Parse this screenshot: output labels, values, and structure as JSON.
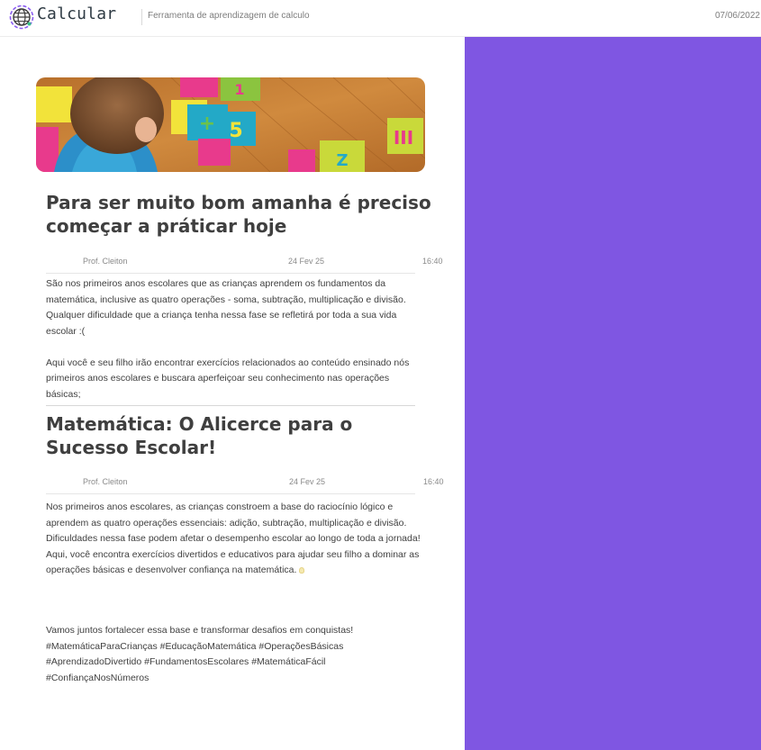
{
  "header": {
    "logo_text": "Calcular",
    "tagline": "Ferramenta de aprendizagem de calculo",
    "date": "07/06/2022"
  },
  "posts": [
    {
      "title": "Para ser muito bom amanha é preciso começar a práticar hoje",
      "author": "Prof. Cleiton",
      "date": "24 Fev 25",
      "time": "16:40",
      "body": "São nos primeiros anos escolares que as crianças aprendem os fundamentos da matemática, inclusive as quatro operações - soma, subtração, multiplicação e divisão. Qualquer dificuldade que a criança tenha nessa fase se refletirá por toda a sua vida escolar :(\n\nAqui você e seu filho irão encontrar exercícios relacionados ao conteúdo ensinado nós primeiros anos escolares e buscara aperfeiçoar seu conhecimento nas operações básicas;"
    },
    {
      "title": "Matemática: O Alicerce para o Sucesso Escolar!",
      "author": "Prof. Cleiton",
      "date": "24 Fev 25",
      "time": "16:40",
      "body_main": "Nos primeiros anos escolares, as crianças constroem a base do raciocínio lógico e aprendem as quatro operações essenciais: adição, subtração, multiplicação e divisão.\nDificuldades nessa fase podem afetar o desempenho escolar ao longo de toda a jornada!\nAqui, você encontra exercícios divertidos e educativos para ajudar seu filho a dominar as operações básicas e desenvolver confiança na matemática.",
      "body_end": "Vamos juntos fortalecer essa base e transformar desafios em conquistas!\n#MatemáticaParaCrianças #EducaçãoMatemática #OperaçõesBásicas #AprendizadoDivertido #FundamentosEscolares #MatemáticaFácil #ConfiançaNosNúmeros"
    }
  ],
  "colors": {
    "accent_panel": "#7f56e2",
    "text": "#3f3f3f",
    "muted": "#8a8a8a"
  },
  "icons": {
    "logo": "globe-icon",
    "bulb": "light-bulb-emoji"
  }
}
